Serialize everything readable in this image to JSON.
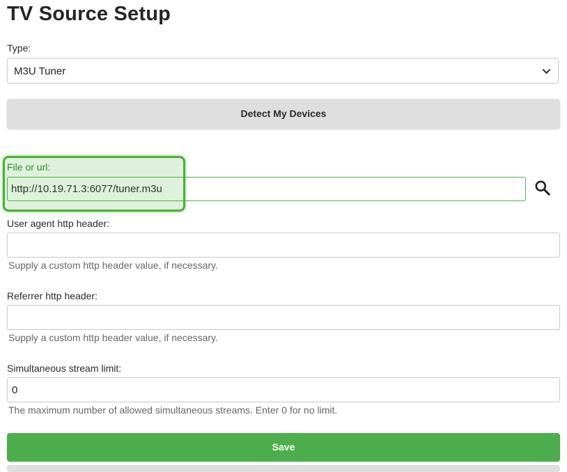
{
  "page": {
    "title": "TV Source Setup"
  },
  "type_field": {
    "label": "Type:",
    "selected": "M3U Tuner"
  },
  "detect_button": {
    "label": "Detect My Devices"
  },
  "url_field": {
    "label": "File or url:",
    "value": "http://10.19.71.3:6077/tuner.m3u",
    "search_icon": "search-icon"
  },
  "user_agent_field": {
    "label": "User agent http header:",
    "value": "",
    "help": "Supply a custom http header value, if necessary."
  },
  "referrer_field": {
    "label": "Referrer http header:",
    "value": "",
    "help": "Supply a custom http header value, if necessary."
  },
  "stream_limit_field": {
    "label": "Simultaneous stream limit:",
    "value": "0",
    "help": "The maximum number of allowed simultaneous streams. Enter 0 for no limit."
  },
  "save_button": {
    "label": "Save"
  },
  "colors": {
    "primary": "#4cae4c",
    "highlight": "#4caf3a",
    "secondary_button": "#dedede"
  }
}
